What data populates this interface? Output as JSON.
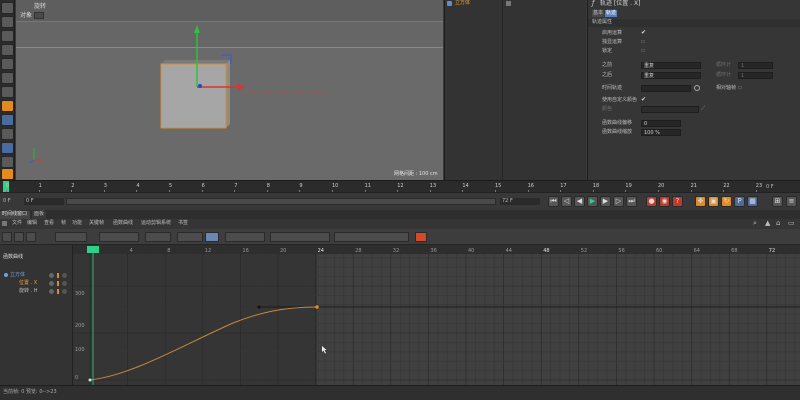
{
  "viewport": {
    "header_line1": "旋转",
    "header_line2": "对象",
    "scale_label": "网格间距 : 100 cm"
  },
  "object_manager": {
    "item_name": "立方体"
  },
  "attributes": {
    "title": "轨迹 [位置 . X]",
    "tabs": [
      "基本",
      "轨迹"
    ],
    "section": "轨迹属性",
    "rows": [
      {
        "label": "启用运算",
        "checked": true
      },
      {
        "label": "独显运算",
        "checked": false
      },
      {
        "label": "锁定",
        "checked": false
      }
    ],
    "before_label": "之前",
    "before_value": "重复",
    "after_label": "之后",
    "after_value": "重复",
    "repeat_label": "循环计",
    "repeat_value": "1",
    "time_track_label": "时间轨迹",
    "relative_label": "相对轴帧",
    "use_color_label": "使用自定义颜色",
    "color_label": "颜色",
    "curve_offset_label": "函数曲线偏移",
    "curve_offset_value": "0",
    "curve_scale_label": "函数曲线缩放",
    "curve_scale_value": "100 %"
  },
  "ruler": {
    "ticks": [
      "0",
      "1",
      "2",
      "3",
      "4",
      "5",
      "6",
      "7",
      "8",
      "9",
      "10",
      "11",
      "12",
      "13",
      "14",
      "15",
      "16",
      "17",
      "18",
      "19",
      "20",
      "21",
      "22",
      "23"
    ],
    "end_frame": "0 F"
  },
  "transport": {
    "current_frame": "0 F",
    "start_field": "0 F",
    "end_field": "72 F",
    "max_field": "72 F"
  },
  "timeline": {
    "tabs": [
      "时间线窗口",
      "面板"
    ],
    "menu": [
      "文件",
      "编辑",
      "查看",
      "帧",
      "功能",
      "关键帧",
      "函数曲线",
      "运动剪辑系统",
      "书签"
    ],
    "left_title": "函数曲线",
    "tree": [
      {
        "name": "立方体",
        "level": 0,
        "color": "#6fa0d8"
      },
      {
        "name": "位置 . X",
        "level": 1,
        "color": "#e8a24a"
      },
      {
        "name": "旋转 . H",
        "level": 1,
        "color": "#bdbdbd"
      }
    ],
    "graph_x_labels": [
      "0",
      "4",
      "8",
      "12",
      "16",
      "20",
      "24",
      "28",
      "32",
      "36",
      "40",
      "44",
      "48",
      "52",
      "56",
      "60",
      "64",
      "68",
      "72"
    ],
    "graph_y_labels": [
      "300",
      "200",
      "100",
      "0"
    ],
    "current_marker": "0"
  },
  "status": {
    "text": "当前帧: 0  预览: 0-->23"
  },
  "colors": {
    "accent": "#e58a1c",
    "curve": "#c9883a",
    "playhead": "#2fd08a"
  }
}
